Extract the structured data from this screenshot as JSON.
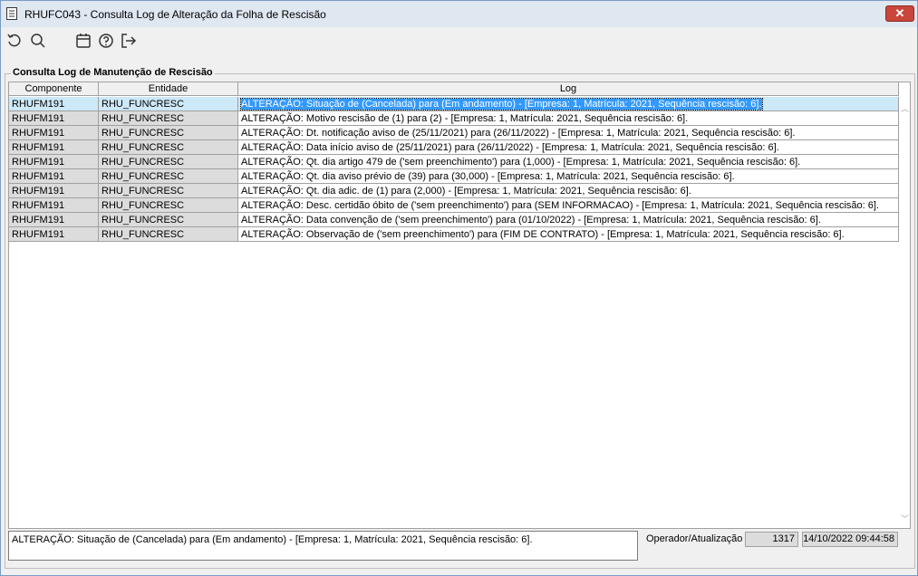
{
  "window": {
    "title": "RHUFC043 - Consulta Log de Alteração da Folha de Rescisão",
    "close_label": "✕"
  },
  "toolbar": {
    "icons": [
      "refresh-icon",
      "search-icon",
      "calendar-icon",
      "help-icon",
      "exit-icon"
    ]
  },
  "group": {
    "label": "Consulta Log de Manutenção de Rescisão"
  },
  "table": {
    "headers": [
      "Componente",
      "Entidade",
      "Log"
    ],
    "rows": [
      [
        "RHUFM191",
        "RHU_FUNCRESC",
        "ALTERAÇÃO: Situação de (Cancelada) para (Em andamento) - [Empresa: 1, Matrícula: 2021, Sequência rescisão: 6]."
      ],
      [
        "RHUFM191",
        "RHU_FUNCRESC",
        "ALTERAÇÃO: Motivo rescisão de (1) para (2) - [Empresa: 1, Matrícula: 2021, Sequência rescisão: 6]."
      ],
      [
        "RHUFM191",
        "RHU_FUNCRESC",
        "ALTERAÇÃO: Dt. notificação aviso de (25/11/2021) para (26/11/2022) - [Empresa: 1, Matrícula: 2021, Sequência rescisão: 6]."
      ],
      [
        "RHUFM191",
        "RHU_FUNCRESC",
        "ALTERAÇÃO: Data início aviso de (25/11/2021) para (26/11/2022) - [Empresa: 1, Matrícula: 2021, Sequência rescisão: 6]."
      ],
      [
        "RHUFM191",
        "RHU_FUNCRESC",
        "ALTERAÇÃO: Qt. dia artigo 479 de ('sem preenchimento') para (1,000) - [Empresa: 1, Matrícula: 2021, Sequência rescisão: 6]."
      ],
      [
        "RHUFM191",
        "RHU_FUNCRESC",
        "ALTERAÇÃO: Qt. dia aviso prévio de (39) para (30,000) - [Empresa: 1, Matrícula: 2021, Sequência rescisão: 6]."
      ],
      [
        "RHUFM191",
        "RHU_FUNCRESC",
        "ALTERAÇÃO: Qt. dia adic. de (1) para (2,000) - [Empresa: 1, Matrícula: 2021, Sequência rescisão: 6]."
      ],
      [
        "RHUFM191",
        "RHU_FUNCRESC",
        "ALTERAÇÃO: Desc. certidão óbito de ('sem preenchimento') para (SEM INFORMACAO) - [Empresa: 1, Matrícula: 2021, Sequência rescisão: 6]."
      ],
      [
        "RHUFM191",
        "RHU_FUNCRESC",
        "ALTERAÇÃO: Data convenção de ('sem preenchimento') para (01/10/2022) - [Empresa: 1, Matrícula: 2021, Sequência rescisão: 6]."
      ],
      [
        "RHUFM191",
        "RHU_FUNCRESC",
        "ALTERAÇÃO: Observação de ('sem preenchimento') para (FIM DE CONTRATO) - [Empresa: 1, Matrícula: 2021, Sequência rescisão: 6]."
      ]
    ],
    "selected_index": 0
  },
  "footer": {
    "log_text": "ALTERAÇÃO: Situação de (Cancelada) para (Em andamento) - [Empresa: 1, Matrícula: 2021, Sequência rescisão: 6].",
    "operator_label": "Operador/Atualização",
    "operator_value": "1317",
    "updated_at": "14/10/2022 09:44:58"
  },
  "colors": {
    "selection": "#3399ff",
    "row_highlight": "#cde8f7",
    "close_button": "#c9463d"
  }
}
